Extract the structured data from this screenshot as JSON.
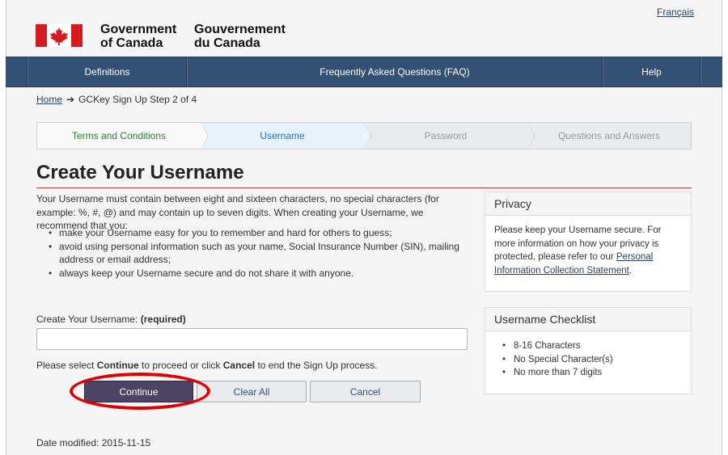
{
  "header": {
    "language_link": "Français",
    "signature_en_line1": "Government",
    "signature_en_line2": "of Canada",
    "signature_fr_line1": "Gouvernement",
    "signature_fr_line2": "du Canada"
  },
  "menu": {
    "definitions": "Definitions",
    "faq": "Frequently Asked Questions (FAQ)",
    "help": "Help"
  },
  "breadcrumb": {
    "home": "Home",
    "separator": "➔",
    "current": "GCKey Sign Up Step 2 of 4"
  },
  "steps": [
    {
      "label": "Terms and Conditions",
      "state": "done"
    },
    {
      "label": "Username",
      "state": "active"
    },
    {
      "label": "Password",
      "state": "pending"
    },
    {
      "label": "Questions and Answers",
      "state": "pending"
    }
  ],
  "main": {
    "title": "Create Your Username",
    "intro": "Your Username must contain between eight and sixteen characters, no special characters (for example: %, #, @) and may contain up to seven digits. When creating your Username, we recommend that you:",
    "bullets": [
      "make your Username easy for you to remember and hard for others to guess;",
      "avoid using personal information such as your name, Social Insurance Number (SIN), mailing address or email address;",
      "always keep your Username secure and do not share it with anyone."
    ],
    "field_label": "Create Your Username:",
    "field_required": "(required)",
    "field_value": "",
    "proceed_1": "Please select ",
    "proceed_continue": "Continue",
    "proceed_2": " to proceed or click ",
    "proceed_cancel": "Cancel",
    "proceed_3": " to end the Sign Up process.",
    "continue_button": "Continue",
    "clear_button": "Clear All",
    "cancel_button": "Cancel",
    "date_modified": "Date modified: 2015-11-15"
  },
  "privacy": {
    "heading": "Privacy",
    "text": "Please keep your Username secure. For more information on how your privacy is protected, please refer to our ",
    "link": "Personal Information Collection Statement",
    "end": "."
  },
  "checklist": {
    "heading": "Username Checklist",
    "items": [
      "8-16 Characters",
      "No Special Character(s)",
      "No more than 7 digits"
    ]
  },
  "colors": {
    "menu_bg": "#335075",
    "continue_bg": "#4b4465",
    "title_rule": "#af3c43",
    "highlight": "#e00000",
    "flag_red": "#d71920"
  }
}
